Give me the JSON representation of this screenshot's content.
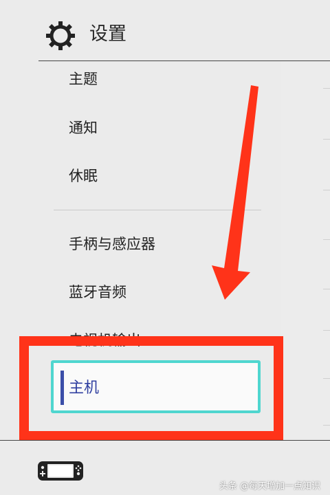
{
  "header": {
    "icon": "gear-icon",
    "title": "设置"
  },
  "menu": {
    "items": [
      {
        "label": "主题"
      },
      {
        "label": "通知"
      },
      {
        "label": "休眠"
      },
      {
        "label": "手柄与感应器"
      },
      {
        "label": "蓝牙音频"
      },
      {
        "label": "电视机输出"
      }
    ],
    "selected": {
      "label": "主机"
    }
  },
  "annotations": {
    "arrow_color": "#ff3319",
    "box_color": "#ff3319",
    "selection_color": "#4fd6cf"
  },
  "footer": {
    "icon": "switch-console-icon"
  },
  "watermark": "头条 @每天增加一点知识"
}
